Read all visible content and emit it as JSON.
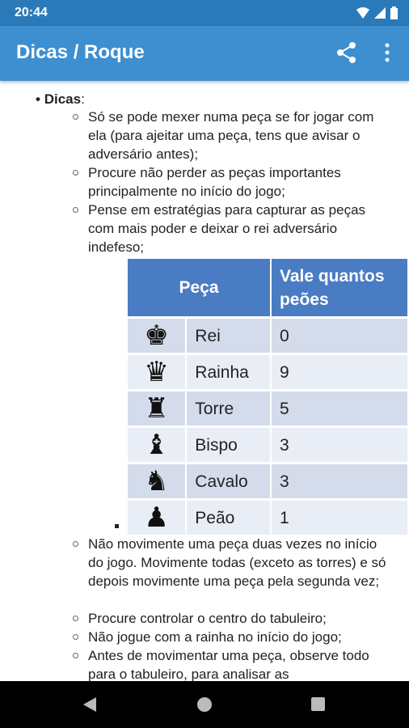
{
  "status": {
    "time": "20:44"
  },
  "appbar": {
    "title": "Dicas / Roque"
  },
  "content": {
    "section_title": "Dicas",
    "section_colon": ":",
    "tips_before": [
      "Só se pode mexer numa peça se for jogar com ela (para ajeitar uma peça, tens que avisar o adversário antes);",
      "Procure não perder as peças importantes principalmente no início do jogo;",
      "Pense em estratégias para capturar as peças com mais poder e deixar o rei adversário indefeso;"
    ],
    "table": {
      "headers": [
        "Peça",
        "Vale quantos peões"
      ],
      "rows": [
        {
          "icon": "king-icon",
          "glyph": "♚",
          "name": "Rei",
          "value": "0"
        },
        {
          "icon": "queen-icon",
          "glyph": "♛",
          "name": "Rainha",
          "value": "9"
        },
        {
          "icon": "rook-icon",
          "glyph": "♜",
          "name": "Torre",
          "value": "5"
        },
        {
          "icon": "bishop-icon",
          "glyph": "♝",
          "name": "Bispo",
          "value": "3"
        },
        {
          "icon": "knight-icon",
          "glyph": "♞",
          "name": "Cavalo",
          "value": "3"
        },
        {
          "icon": "pawn-icon",
          "glyph": "♟",
          "name": "Peão",
          "value": "1"
        }
      ]
    },
    "tips_after": [
      "Não movimente uma peça duas vezes no início do jogo. Movimente todas (exceto as torres) e só depois movimente uma peça pela segunda vez;",
      "Procure controlar o centro do tabuleiro;",
      "Não jogue com a rainha no início do jogo;",
      "Antes de movimentar uma peça, observe todo para o tabuleiro, para analisar as"
    ]
  },
  "colors": {
    "statusbar": "#2a7ab9",
    "appbar": "#3d8fd0",
    "table_header": "#4a7cc3"
  }
}
